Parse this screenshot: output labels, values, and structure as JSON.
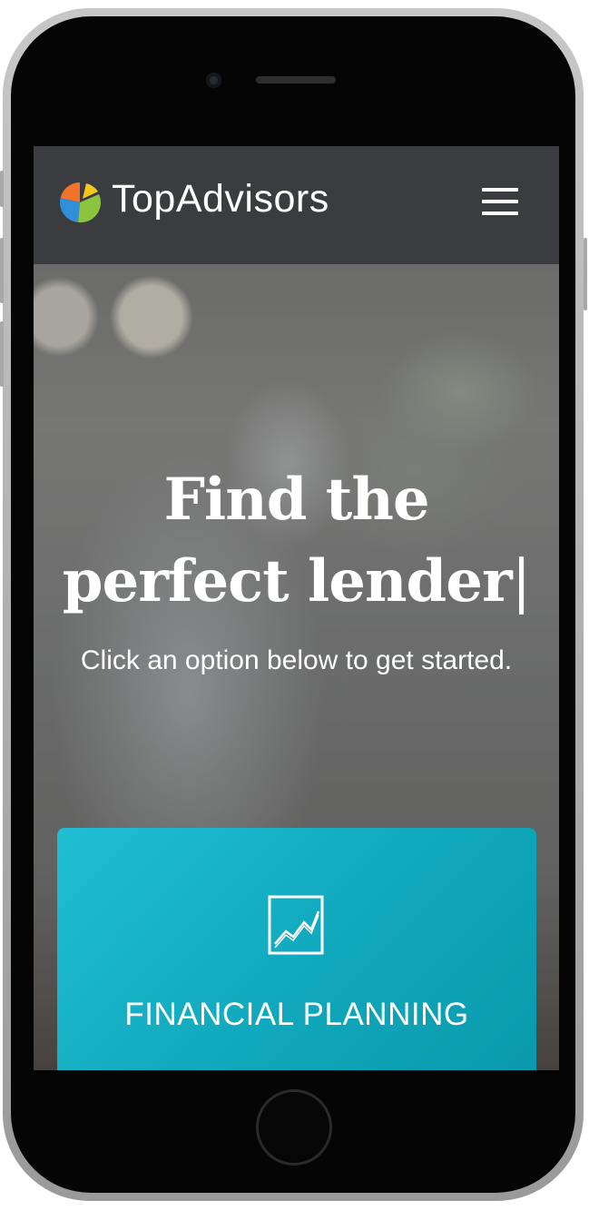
{
  "header": {
    "brand": "TopAdvisors",
    "logo_icon": "pie-chart-logo-icon",
    "menu_icon": "hamburger-menu-icon"
  },
  "hero": {
    "title_line1": "Find the",
    "title_line2": "perfect lender",
    "cursor": "|",
    "subtitle": "Click an option below to get started."
  },
  "options": [
    {
      "label": "FINANCIAL PLANNING",
      "icon": "line-chart-icon"
    }
  ],
  "colors": {
    "card_accent": "#15b3c7",
    "logo_orange": "#f2742a",
    "logo_blue": "#2f8fd8",
    "logo_green": "#8bc53f",
    "logo_yellow": "#f6c71b"
  }
}
